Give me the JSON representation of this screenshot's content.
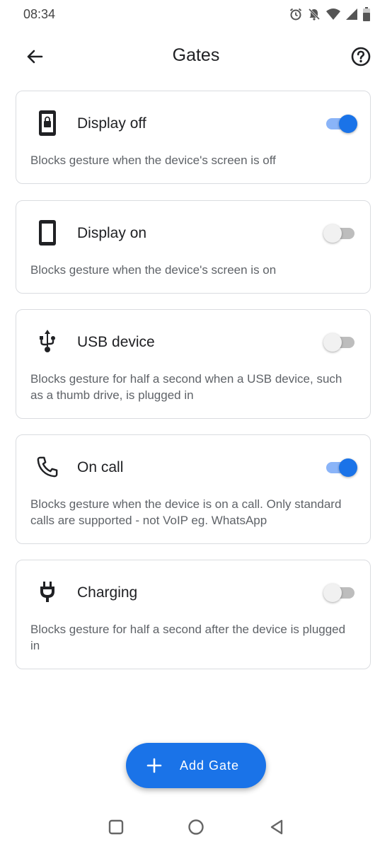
{
  "status_bar": {
    "time": "08:34",
    "icons": [
      "alarm-icon",
      "mute-icon",
      "wifi-icon",
      "signal-icon",
      "battery-icon"
    ]
  },
  "header": {
    "title": "Gates",
    "back_icon": "arrow-left-icon",
    "help_icon": "help-circle-icon"
  },
  "gates": [
    {
      "icon": "lock-phone-icon",
      "title": "Display off",
      "description": "Blocks gesture when the device's screen is off",
      "enabled": true
    },
    {
      "icon": "phone-icon",
      "title": "Display on",
      "description": "Blocks gesture when the device's screen is on",
      "enabled": false
    },
    {
      "icon": "usb-icon",
      "title": "USB device",
      "description": "Blocks gesture for half a second when a USB device, such as a thumb drive, is plugged in",
      "enabled": false
    },
    {
      "icon": "call-icon",
      "title": "On call",
      "description": "Blocks gesture when the device is on a call. Only standard calls are supported - not VoIP eg. WhatsApp",
      "enabled": true
    },
    {
      "icon": "plug-icon",
      "title": "Charging",
      "description": "Blocks gesture for half a second after the device is plugged in",
      "enabled": false
    }
  ],
  "fab": {
    "label": "Add Gate",
    "icon": "plus-icon"
  },
  "nav": {
    "icons": [
      "recents-icon",
      "home-icon",
      "back-icon"
    ]
  },
  "colors": {
    "accent": "#1a73e8",
    "accent_track": "#8ab4f8"
  }
}
